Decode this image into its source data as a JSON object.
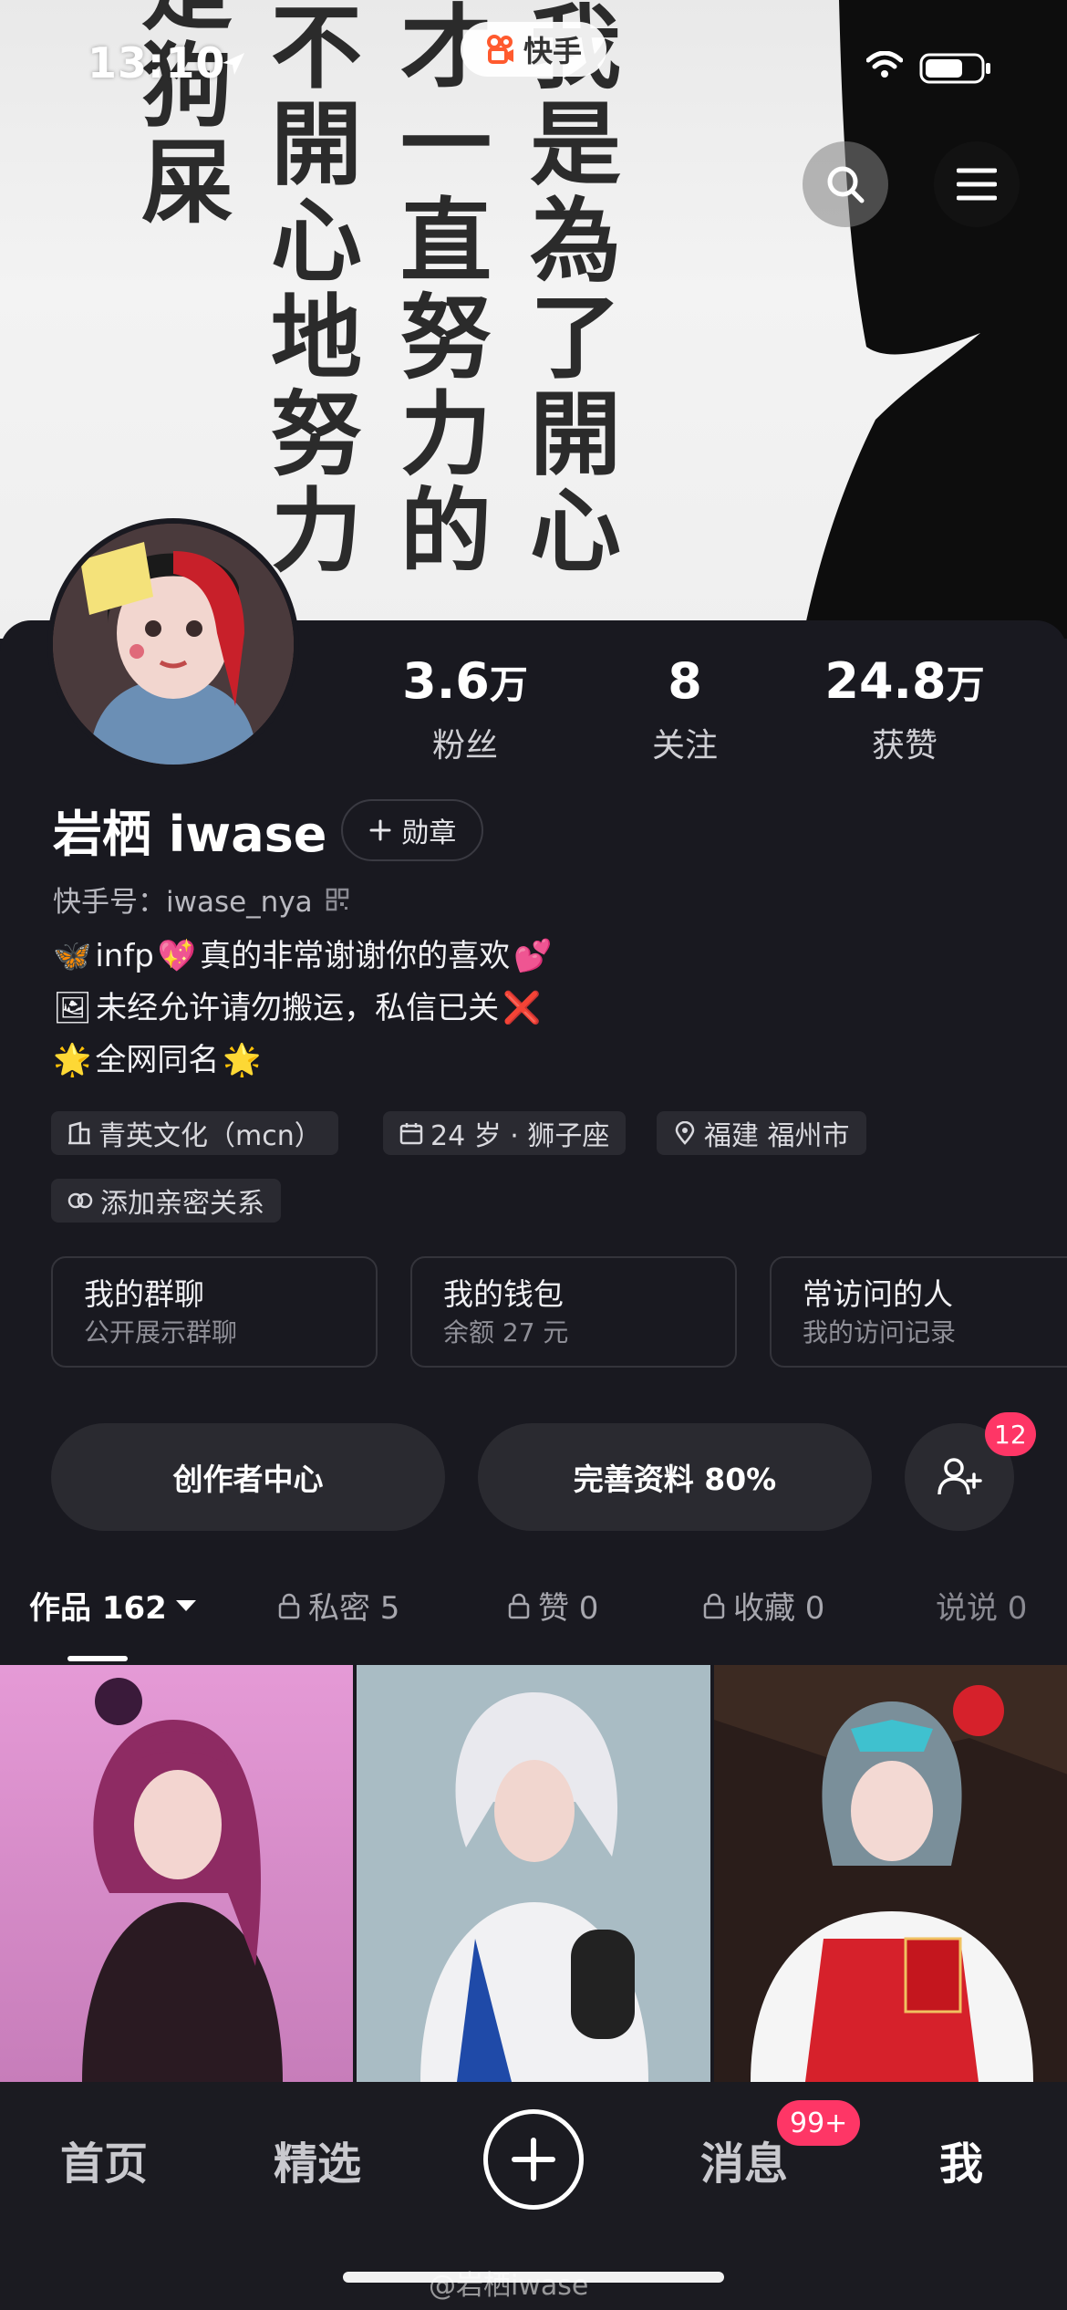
{
  "status_bar": {
    "time": "13:10",
    "app_name": "快手"
  },
  "cover": {
    "columns": [
      [
        "我",
        "是",
        "為",
        "了",
        "開",
        "心"
      ],
      [
        "才",
        "一",
        "直",
        "努",
        "力",
        "的"
      ],
      [
        "不",
        "開",
        "心",
        "地",
        "努",
        "力"
      ],
      [
        "是",
        "狗",
        "屎"
      ]
    ]
  },
  "header_buttons": {
    "search_icon": "search-icon",
    "menu_icon": "menu-icon"
  },
  "stats": [
    {
      "value": "3.6",
      "unit": "万",
      "label": "粉丝"
    },
    {
      "value": "8",
      "unit": "",
      "label": "关注"
    },
    {
      "value": "24.8",
      "unit": "万",
      "label": "获赞"
    }
  ],
  "profile": {
    "name": "岩栖 iwase",
    "badge_label": "勋章",
    "kuaishou_id": "快手号：iwase_nya",
    "bio": [
      {
        "pre": "🦋",
        "text": "infp",
        "mid": "💖",
        "text2": "真的非常谢谢你的喜欢",
        "post": "💕"
      },
      {
        "pre": "🖼",
        "text": "未经允许请勿搬运，私信已关",
        "post": "❌"
      },
      {
        "pre": "🌟",
        "text": "全网同名",
        "post": "🌟"
      }
    ]
  },
  "tags": [
    {
      "icon": "building-icon",
      "label": "青英文化（mcn）"
    },
    {
      "icon": "calendar-icon",
      "label": "24 岁 · 狮子座"
    },
    {
      "icon": "location-icon",
      "label": "福建 福州市"
    },
    {
      "icon": "link-icon",
      "label": "添加亲密关系"
    }
  ],
  "cards": [
    {
      "title": "我的群聊",
      "subtitle": "公开展示群聊"
    },
    {
      "title": "我的钱包",
      "subtitle": "余额 27 元"
    },
    {
      "title": "常访问的人",
      "subtitle": "我的访问记录"
    }
  ],
  "actions": {
    "creator_center": "创作者中心",
    "complete_profile": "完善资料 80%",
    "friend_requests": "12"
  },
  "tabs": [
    {
      "label": "作品 162",
      "active": true,
      "locked": false
    },
    {
      "label": "私密 5",
      "active": false,
      "locked": true
    },
    {
      "label": "赞 0",
      "active": false,
      "locked": true
    },
    {
      "label": "收藏 0",
      "active": false,
      "locked": true
    },
    {
      "label": "说说 0",
      "active": false,
      "locked": false
    }
  ],
  "bottom_nav": {
    "home": "首页",
    "featured": "精选",
    "messages": "消息",
    "messages_badge": "99+",
    "me": "我"
  },
  "watermark": "@岩栖iwase",
  "colors": {
    "accent": "#fe3666",
    "background": "#191920",
    "surface": "#2a2a30"
  }
}
